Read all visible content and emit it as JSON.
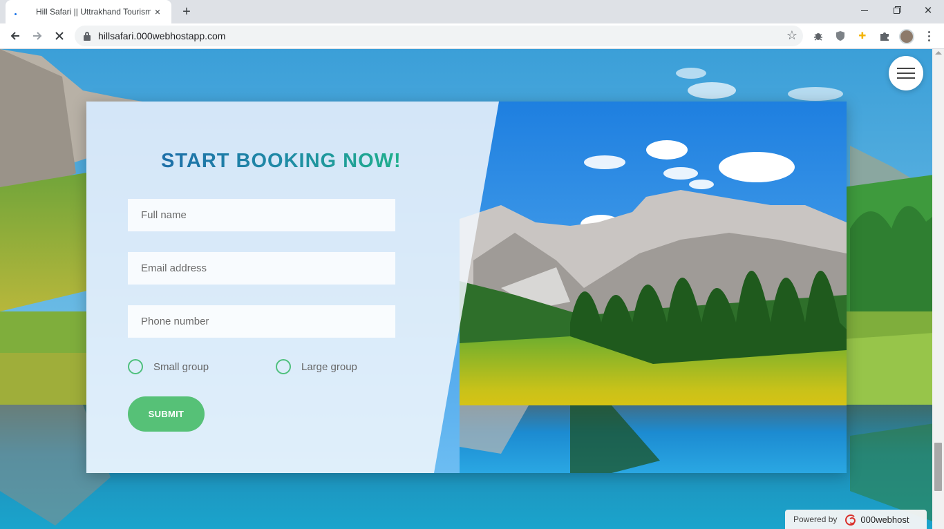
{
  "browser": {
    "tab_title": "Hill Safari || Uttrakhand Tourism",
    "tab_close_icon": "×",
    "new_tab_icon": "+",
    "url": "hillsafari.000webhostapp.com"
  },
  "page": {
    "booking": {
      "title": "START BOOKING NOW!",
      "fields": {
        "full_name_placeholder": "Full name",
        "email_placeholder": "Email address",
        "phone_placeholder": "Phone number"
      },
      "group_options": [
        "Small group",
        "Large group"
      ],
      "submit_label": "SUBMIT"
    },
    "footer": {
      "powered_by": "Powered by",
      "host_brand": "000webhost"
    }
  },
  "colors": {
    "accent_green": "#56c177",
    "title_gradient_start": "#1e6fa8",
    "title_gradient_end": "#20b08c"
  }
}
